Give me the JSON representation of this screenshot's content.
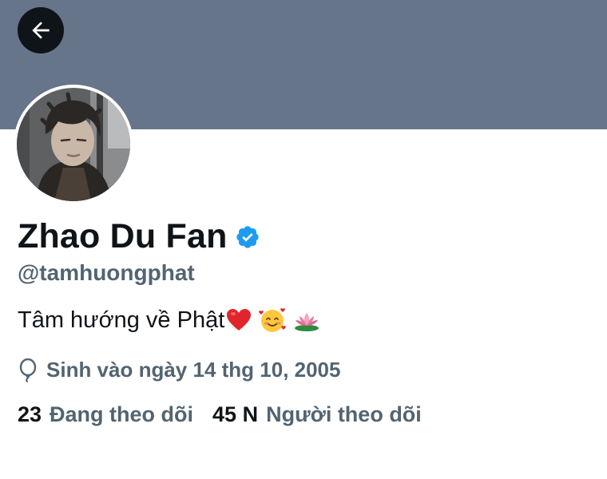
{
  "profile": {
    "display_name": "Zhao Du Fan",
    "handle": "@tamhuongphat",
    "bio_text": "Tâm hướng về Phật",
    "bio_icons": [
      "red-heart-icon",
      "smiling-face-with-hearts-icon",
      "lotus-icon"
    ],
    "verified": true,
    "birthday": "Sinh vào ngày 14 thg 10, 2005"
  },
  "stats": {
    "following_count": "23",
    "following_label": "Đang theo dõi",
    "followers_count": "45 N",
    "followers_label": "Người theo dõi"
  },
  "icons": {
    "back": "arrow-left-icon",
    "verified": "verified-badge-icon",
    "birthday": "balloon-icon"
  },
  "colors": {
    "banner": "#66758a",
    "text_primary": "#0f1419",
    "text_secondary": "#536471",
    "verified_blue": "#1d9bf0"
  }
}
